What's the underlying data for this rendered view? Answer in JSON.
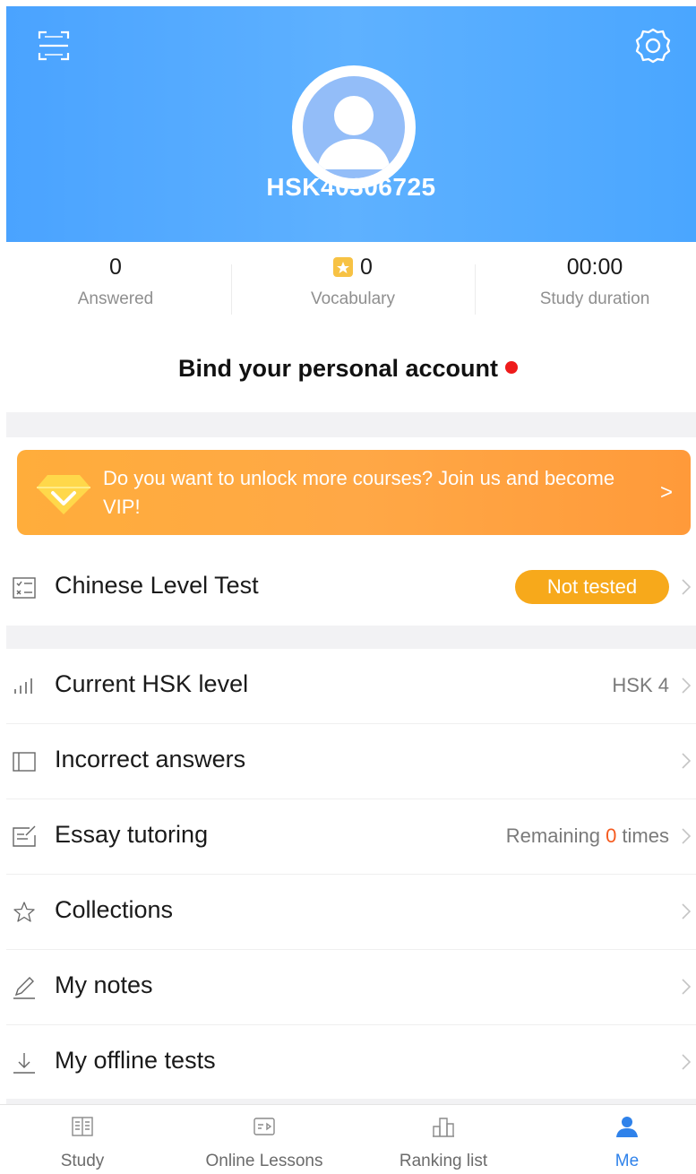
{
  "header": {
    "username": "HSK40306725"
  },
  "stats": [
    {
      "value": "0",
      "label": "Answered"
    },
    {
      "value": "0",
      "label": "Vocabulary"
    },
    {
      "value": "00:00",
      "label": "Study duration"
    }
  ],
  "bind_account": "Bind your personal account",
  "vip_banner": {
    "text": "Do you want to unlock more courses? Join us and become VIP!",
    "arrow": ">"
  },
  "level_test": {
    "label": "Chinese Level Test",
    "status": "Not tested"
  },
  "menu": {
    "hsk_level": {
      "label": "Current HSK level",
      "value": "HSK 4"
    },
    "incorrect": {
      "label": "Incorrect answers"
    },
    "essay": {
      "label": "Essay tutoring",
      "value_prefix": "Remaining ",
      "value_num": "0",
      "value_suffix": " times"
    },
    "collections": {
      "label": "Collections"
    },
    "notes": {
      "label": "My notes"
    },
    "offline": {
      "label": "My offline tests"
    }
  },
  "tabs": [
    {
      "label": "Study",
      "icon": "book-icon"
    },
    {
      "label": "Online Lessons",
      "icon": "video-icon"
    },
    {
      "label": "Ranking list",
      "icon": "ranking-icon"
    },
    {
      "label": "Me",
      "icon": "person-icon",
      "active": true
    }
  ],
  "colors": {
    "header_blue": "#4aa3ff",
    "accent_blue": "#2f82ea",
    "vip_orange": "#ffa846",
    "badge_orange": "#f7a91b",
    "red_dot": "#ee1b1b"
  }
}
